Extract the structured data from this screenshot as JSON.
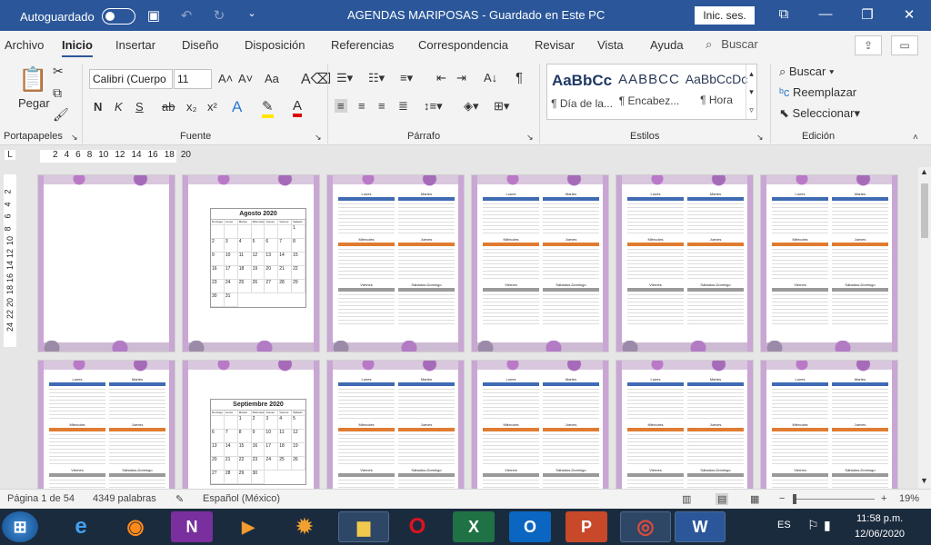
{
  "titlebar": {
    "autosave_label": "Autoguardado",
    "document_title": "AGENDAS MARIPOSAS  -  Guardado en Este PC",
    "signin_label": "Inic. ses.",
    "icons": [
      "save-icon",
      "undo-icon",
      "redo-icon",
      "customize-qat-icon"
    ],
    "window_controls": [
      "ribbon-display-icon",
      "minimize-icon",
      "restore-icon",
      "close-icon"
    ]
  },
  "menu": {
    "tabs": [
      "Archivo",
      "Inicio",
      "Insertar",
      "Diseño",
      "Disposición",
      "Referencias",
      "Correspondencia",
      "Revisar",
      "Vista",
      "Ayuda"
    ],
    "active_tab": "Inicio",
    "search_label": "Buscar"
  },
  "ribbon": {
    "clipboard": {
      "paste_label": "Pegar",
      "group_label": "Portapapeles"
    },
    "font": {
      "font_name": "Calibri (Cuerpo",
      "font_size": "11",
      "group_label": "Fuente",
      "change_case": "Aa",
      "bold": "N",
      "italic": "K",
      "underline": "S",
      "strike": "ab",
      "subscript": "x₂",
      "superscript": "x²"
    },
    "paragraph": {
      "group_label": "Párrafo",
      "pilcrow": "¶"
    },
    "styles": {
      "group_label": "Estilos",
      "items": [
        {
          "sample": "AaBbCc",
          "name": "¶ Día de la..."
        },
        {
          "sample": "AABBCC",
          "name": "¶ Encabez..."
        },
        {
          "sample": "AaBbCcDc",
          "name": "¶ Hora"
        }
      ]
    },
    "editing": {
      "group_label": "Edición",
      "find": "Buscar",
      "replace": "Reemplazar",
      "select": "Seleccionar"
    }
  },
  "ruler": {
    "ticks": [
      "2",
      "4",
      "6",
      "8",
      "10",
      "12",
      "14",
      "16",
      "18",
      "20"
    ],
    "vticks": [
      "2",
      "4",
      "6",
      "8",
      "10",
      "12",
      "14",
      "16",
      "18",
      "20",
      "22",
      "24"
    ]
  },
  "pages": {
    "calendar_aug": {
      "title": "Agosto 2020",
      "days": [
        "1",
        "2",
        "3",
        "4",
        "5",
        "6",
        "7",
        "8",
        "9",
        "10",
        "11",
        "12",
        "13",
        "14",
        "15",
        "16",
        "17",
        "18",
        "19",
        "20",
        "21",
        "22",
        "23",
        "24",
        "25",
        "26",
        "27",
        "28",
        "29",
        "30",
        "31"
      ]
    },
    "calendar_sep": {
      "title": "Septiembre 2020",
      "days": [
        "1",
        "2",
        "3",
        "4",
        "5",
        "6",
        "7",
        "8",
        "9",
        "10",
        "11",
        "12",
        "13",
        "14",
        "15",
        "16",
        "17",
        "18",
        "19",
        "20",
        "21",
        "22",
        "23",
        "24",
        "25",
        "26",
        "27",
        "28",
        "29",
        "30"
      ]
    },
    "agenda_days": [
      "Lunes",
      "Martes",
      "Miércoles",
      "Jueves",
      "Viernes",
      "Sábados-Domingo"
    ],
    "weekday_headers": [
      "Domingo",
      "Lunes",
      "Martes",
      "Miércoles",
      "Jueves",
      "Viernes",
      "Sábado"
    ]
  },
  "status": {
    "page": "Página 1 de 54",
    "words": "4349 palabras",
    "language": "Español (México)",
    "zoom": "19%",
    "zoom_level": 0.19
  },
  "taskbar": {
    "apps": [
      "start-icon",
      "internet-explorer-icon",
      "firefox-icon",
      "onenote-icon",
      "media-player-icon",
      "settings-app-icon",
      "file-explorer-icon",
      "opera-icon",
      "excel-icon",
      "outlook-icon",
      "powerpoint-icon",
      "chrome-icon",
      "word-icon"
    ],
    "lang": "ES",
    "time": "11:58 p.m.",
    "date": "12/06/2020"
  },
  "colors": {
    "accent": "#2b579a",
    "taskbar": "#1b2b3e",
    "bar_blue": "#3f6bb4",
    "bar_orange": "#e07b2f",
    "bar_gray": "#9a9a9a"
  }
}
